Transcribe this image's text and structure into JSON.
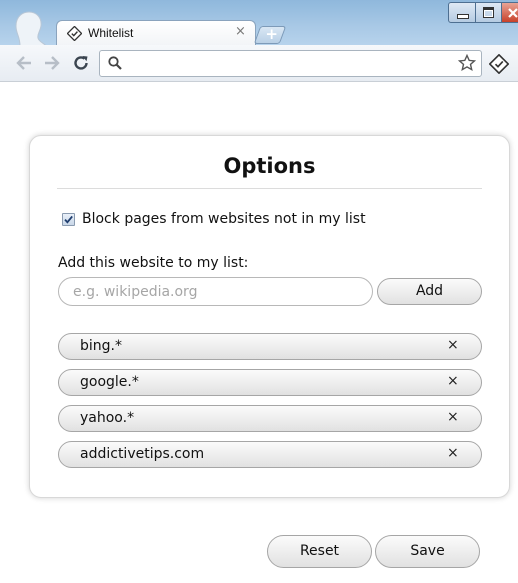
{
  "browser": {
    "tab_title": "Whitelist",
    "tab_close": "×",
    "new_tab": "+",
    "omnibox_value": ""
  },
  "options": {
    "title": "Options",
    "block_label": "Block pages from websites not in my list",
    "block_checked": true,
    "add_label": "Add this website to my list:",
    "input_placeholder": "e.g. wikipedia.org",
    "add_button": "Add",
    "remove_glyph": "×",
    "sites": [
      "bing.*",
      "google.*",
      "yahoo.*",
      "addictivetips.com"
    ]
  },
  "footer": {
    "reset_button": "Reset",
    "save_button": "Save"
  },
  "icons": {
    "profile": "profile-avatar-icon",
    "favicon": "diamond-check-icon",
    "back": "back-arrow-icon",
    "forward": "forward-arrow-icon",
    "reload": "reload-icon",
    "search": "search-icon",
    "star": "star-icon",
    "extension": "whitelist-extension-icon"
  },
  "colors": {
    "titlebar": "#a9c9e6",
    "checkbox_check": "#1f3d6e",
    "close_button": "#c7412b"
  }
}
